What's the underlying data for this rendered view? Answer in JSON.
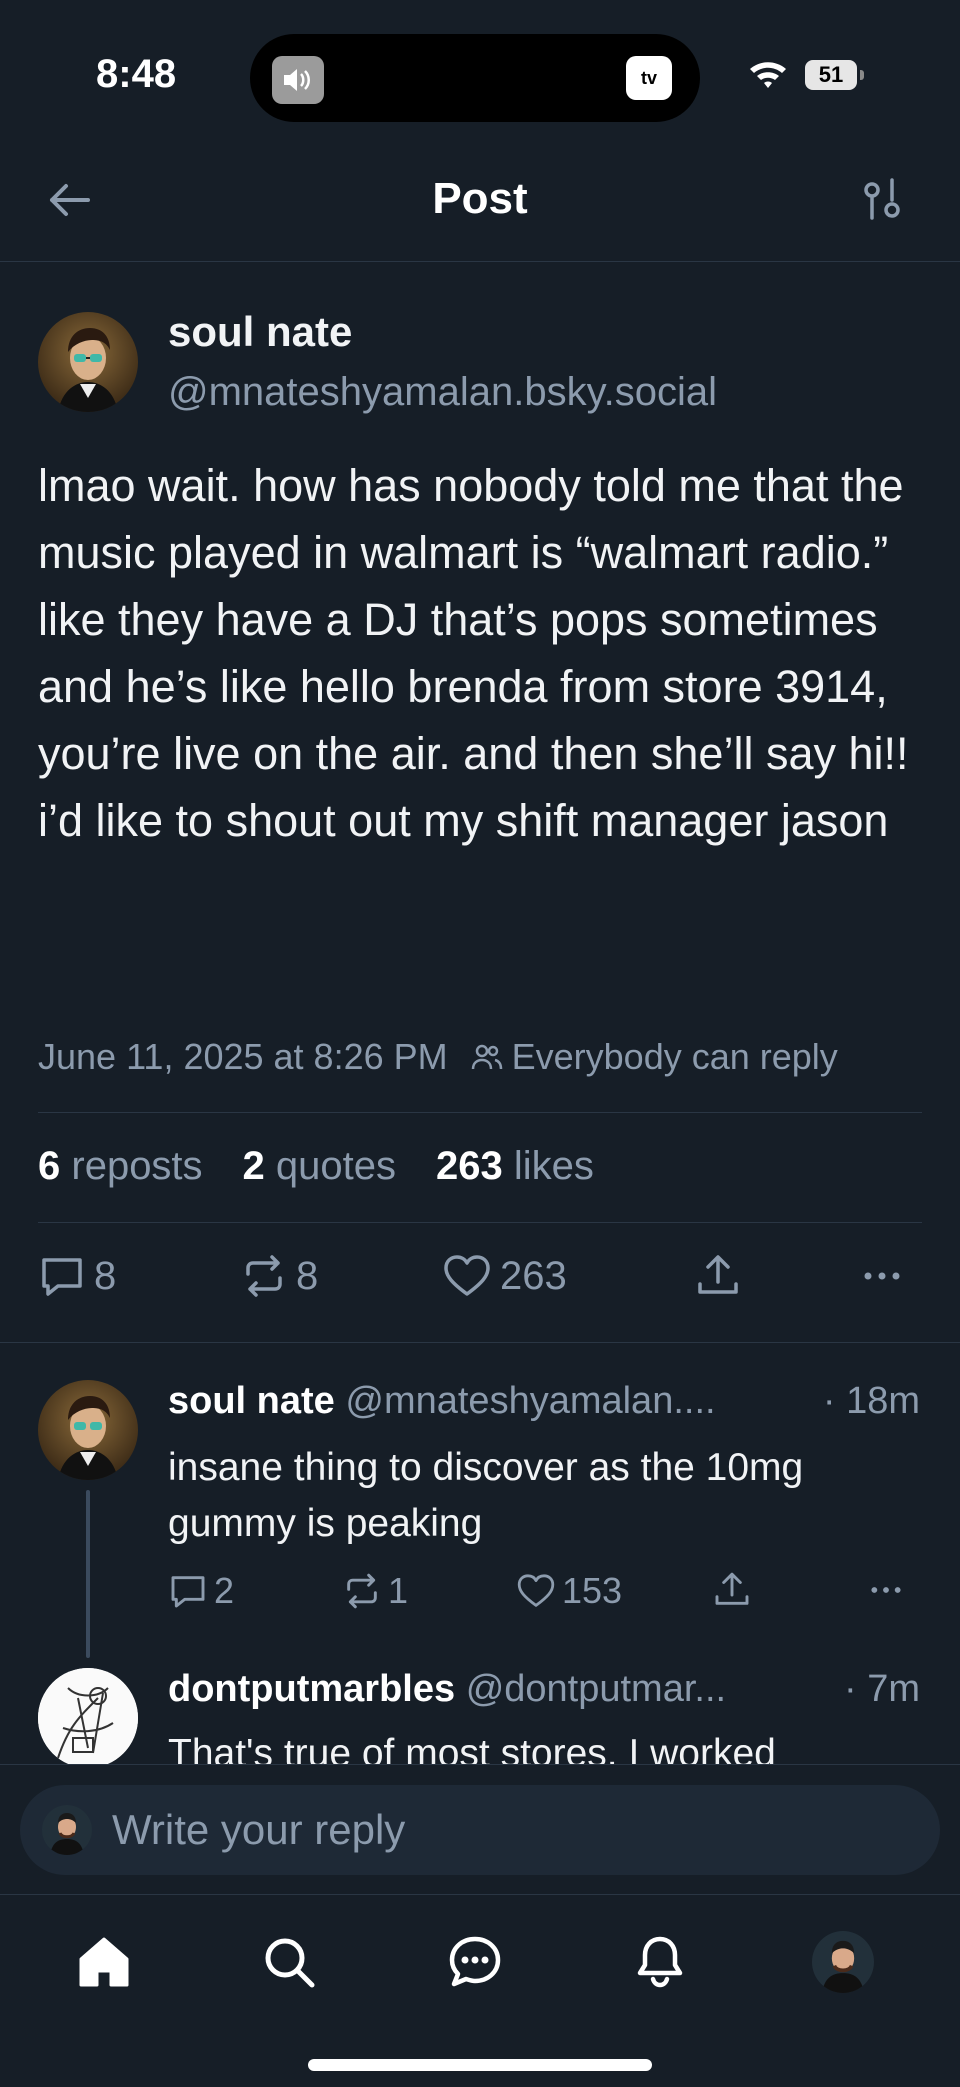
{
  "status_bar": {
    "time": "8:48",
    "tv_label": "tv",
    "battery": "51"
  },
  "header": {
    "title": "Post"
  },
  "post": {
    "author_name": "soul nate",
    "author_handle": "@mnateshyamalan.bsky.social",
    "text": "lmao wait. how has nobody told me that the music played in walmart is “walmart radio.” like they have a DJ that’s pops sometimes and he’s like hello brenda from store 3914, you’re live on the air. and then she’ll say hi!! i’d like to shout out my shift manager jason",
    "timestamp": "June 11, 2025 at 8:26 PM",
    "reply_setting": "Everybody can reply",
    "stats": {
      "reposts_count": "6",
      "reposts_label": "reposts",
      "quotes_count": "2",
      "quotes_label": "quotes",
      "likes_count": "263",
      "likes_label": "likes"
    },
    "actions": {
      "reply_count": "8",
      "repost_count": "8",
      "like_count": "263"
    }
  },
  "replies": [
    {
      "name": "soul nate",
      "handle": "@mnateshyamalan....",
      "time": "· 18m",
      "text": "insane thing to discover as the 10mg gummy is peaking",
      "reply_count": "2",
      "repost_count": "1",
      "like_count": "153"
    },
    {
      "name": "dontputmarbles",
      "handle": "@dontputmar...",
      "time": "· 7m",
      "text": "That's true of most stores. I worked"
    }
  ],
  "composer": {
    "placeholder": "Write your reply"
  },
  "colors": {
    "background": "#161e27",
    "muted_text": "#8c9bad",
    "divider": "#2a3644",
    "composer_bg": "#1e2936"
  },
  "icons": {
    "back": "arrow-left-icon",
    "filter": "sliders-icon",
    "reply": "speech-bubble-icon",
    "repost": "repost-arrows-icon",
    "like": "heart-icon",
    "share": "share-upload-icon",
    "more": "ellipsis-icon",
    "home": "home-icon",
    "search": "search-icon",
    "chat": "chat-icon",
    "notifications": "bell-icon",
    "people": "people-icon"
  }
}
